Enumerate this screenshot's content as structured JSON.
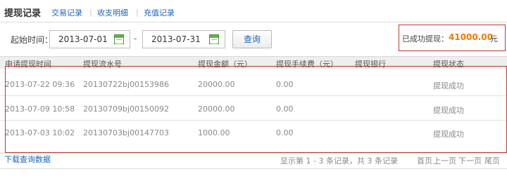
{
  "tabs": {
    "active": "提现记录",
    "items": [
      "交易记录",
      "收支明细",
      "充值记录"
    ]
  },
  "search": {
    "start_label": "起始时间：",
    "start_date": "2013-07-01",
    "separator": "-",
    "end_date": "2013-07-31",
    "query_label": "查询"
  },
  "summary": {
    "label": "已成功提现：",
    "amount": "41000.00",
    "unit": "元"
  },
  "table": {
    "columns": [
      "申请提现时间",
      "提现流水号",
      "提现金额（元）",
      "提现手续费（元）",
      "提现银行",
      "提现状态"
    ],
    "rows": [
      [
        "2013-07-22 09:36",
        "20130722bj00153986",
        "20000.00",
        "0.00",
        "",
        "提现成功"
      ],
      [
        "2013-07-09 10:58",
        "20130709bj00150092",
        "20000.00",
        "0.00",
        "",
        "提现成功"
      ],
      [
        "2013-07-03 10:02",
        "20130703bj00147703",
        "1000.00",
        "0.00",
        "",
        "提现成功"
      ]
    ]
  },
  "footer": {
    "download_label": "下载查询数据",
    "summary": "显示第 1 - 3 条记录，共 3 条记录",
    "first": "首页",
    "prev": "上一页",
    "next": "下一页",
    "last": "尾页"
  },
  "colors": {
    "link": "#1a64b8",
    "amount": "#f07800",
    "highlight_border": "#c0392b"
  }
}
